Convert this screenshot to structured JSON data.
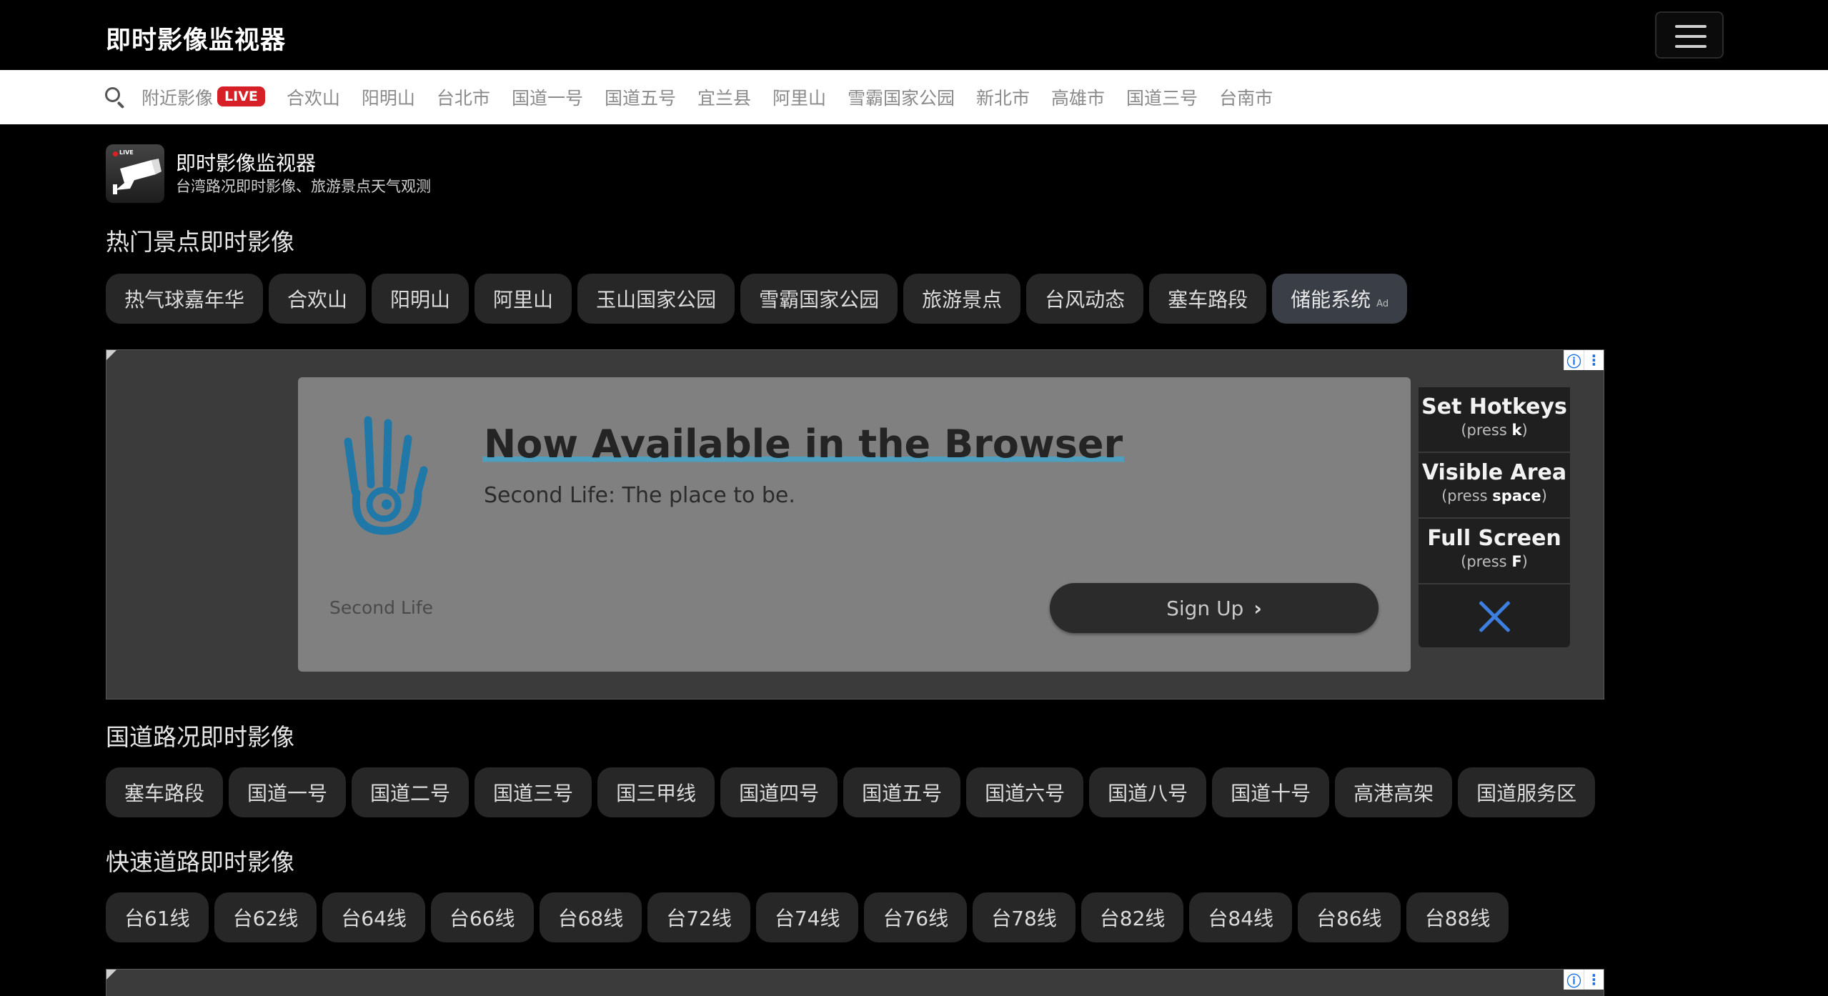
{
  "header": {
    "brand": "即时影像监视器"
  },
  "nav": {
    "first": "附近影像",
    "live_badge": "LIVE",
    "links": [
      "合欢山",
      "阳明山",
      "台北市",
      "国道一号",
      "国道五号",
      "宜兰县",
      "阿里山",
      "雪霸国家公园",
      "新北市",
      "高雄市",
      "国道三号",
      "台南市"
    ]
  },
  "site": {
    "logo_text": "LIVE",
    "title": "即时影像监视器",
    "subtitle": "台湾路况即时影像、旅游景点天气观测"
  },
  "sections": {
    "popular": {
      "title": "热门景点即时影像",
      "chips": [
        "热气球嘉年华",
        "合欢山",
        "阳明山",
        "阿里山",
        "玉山国家公园",
        "雪霸国家公园",
        "旅游景点",
        "台风动态",
        "塞车路段"
      ],
      "ad_chip": "储能系统",
      "ad_chip_mark": "Ad"
    },
    "highway": {
      "title": "国道路况即时影像",
      "chips": [
        "塞车路段",
        "国道一号",
        "国道二号",
        "国道三号",
        "国三甲线",
        "国道四号",
        "国道五号",
        "国道六号",
        "国道八号",
        "国道十号",
        "高港高架",
        "国道服务区"
      ]
    },
    "expressway": {
      "title": "快速道路即时影像",
      "chips": [
        "台61线",
        "台62线",
        "台64线",
        "台66线",
        "台68线",
        "台72线",
        "台74线",
        "台76线",
        "台78线",
        "台82线",
        "台84线",
        "台86线",
        "台88线"
      ]
    }
  },
  "ad": {
    "headline": "Now Available in the Browser",
    "description": "Second Life: The place to be.",
    "brand": "Second Life",
    "cta": "Sign Up",
    "info_icon": "ⓘ",
    "menu_icon": "⋮",
    "shortcuts": [
      {
        "title": "Set Hotkeys",
        "press": "(press ",
        "key": "k",
        "close": ")"
      },
      {
        "title": "Visible Area",
        "press": "(press ",
        "key": "space",
        "close": ")"
      },
      {
        "title": "Full Screen",
        "press": "(press ",
        "key": "F",
        "close": ")"
      }
    ],
    "accent_color": "#3c7fe0"
  }
}
